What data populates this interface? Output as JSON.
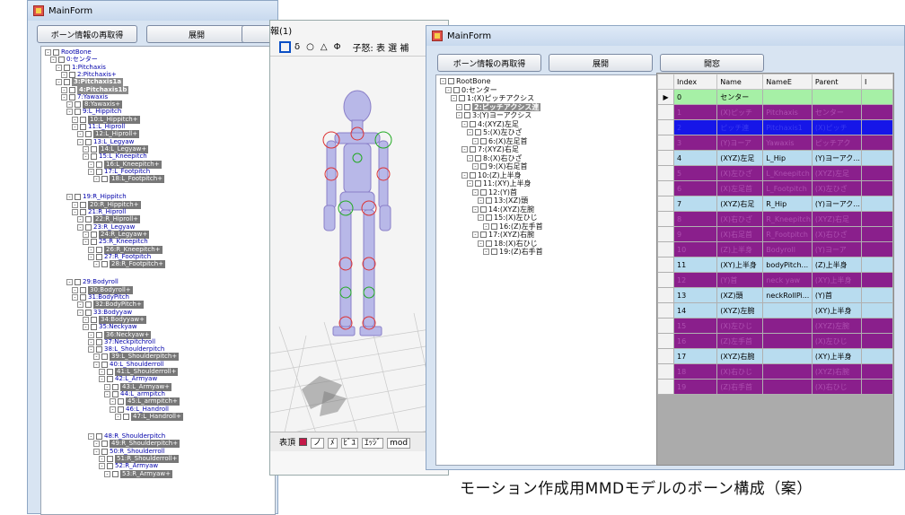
{
  "colors": {
    "row_green": "#a6f0a6",
    "row_purple": "#8a1f8c",
    "row_blue": "#1616e8",
    "row_cyan": "#b8dcef",
    "row_purple_text": "#ad4fb0"
  },
  "left_window": {
    "title": "MainForm",
    "btn_reload": "ボーン情報の再取得",
    "btn_expand": "展開",
    "tree": [
      "RootBone",
      "0:センター",
      "1:Pitchaxis",
      "2:Pitchaxis+",
      "3:Pitchaxis1a",
      "4:Pitchaxis1b",
      "7:Yawaxis",
      "8:Yawaxis+",
      "9:L_Hippitch",
      "10:L_Hippitch+",
      "11:L_Hiproll",
      "12:L_Hiproll+",
      "13:L_Legyaw",
      "14:L_Legyaw+",
      "15:L_Kneepitch",
      "16:L_Kneepitch+",
      "17:L_Footpitch",
      "18:L_Footpitch+",
      "19:R_Hippitch",
      "20:R_Hippitch+",
      "21:R_Hiproll",
      "22:R_Hiproll+",
      "23:R_Legyaw",
      "24:R_Legyaw+",
      "25:R_Kneepitch",
      "26:R_Kneepitch+",
      "27:R_Footpitch",
      "28:R_Footpitch+",
      "29:Bodyroll",
      "30:Bodyroll+",
      "31:BodyPitch",
      "32:BodyPitch+",
      "33:Bodyyaw",
      "34:Bodyyaw+",
      "35:Neckyaw",
      "36:Neckyaw+",
      "37:Neckpitchroll",
      "38:L_Shoulderpitch",
      "39:L_Shoulderpitch+",
      "40:L_Shoulderroll",
      "41:L_Shoulderroll+",
      "42:L_Armyaw",
      "43:L_Armyaw+",
      "44:L_armpitch",
      "45:L_armpitch+",
      "46:L_Handroll",
      "47:L_Handroll+",
      "48:R_Shoulderpitch",
      "49:R_Shoulderpitch+",
      "50:R_Shoulderroll",
      "51:R_Shoulderroll+",
      "52:R_Armyaw",
      "53:R_Armyaw+"
    ]
  },
  "middle_window": {
    "title_fragment": "報(1)",
    "toolbar_symbols": [
      "δ",
      "○",
      "△",
      "Φ"
    ],
    "toolbar_text": "子怒: 表 選 補",
    "status_text": "表頂",
    "status_items": [
      "ノ",
      "ﾒ",
      "ﾋﾞﾕ",
      "ｴｯｼﾞ",
      "mod"
    ]
  },
  "right_window": {
    "title": "MainForm",
    "btn_reload": "ボーン情報の再取得",
    "btn_expand": "展開",
    "btn_open": "開窓",
    "tree": [
      "RootBone",
      "0:センター",
      "1:(X)ピッチアクシス",
      "2:ピッチアクシス連",
      "3:(Y)ヨーアクシス",
      "4:(XYZ)左足",
      "5:(X)左ひざ",
      "6:(X)左足首",
      "7:(XYZ)右足",
      "8:(X)右ひざ",
      "9:(X)右足首",
      "10:(Z)上半身",
      "11:(XY)上半身",
      "12:(Y)首",
      "13:(XZ)頭",
      "14:(XYZ)左腕",
      "15:(X)左ひじ",
      "16:(Z)左手首",
      "17:(XYZ)右腕",
      "18:(X)右ひじ",
      "19:(Z)右手首"
    ],
    "grid": {
      "columns": [
        "Index",
        "Name",
        "NameE",
        "Parent",
        "I"
      ],
      "rows": [
        {
          "index": "0",
          "name": "センター",
          "nameE": "",
          "parent": "",
          "style": "green",
          "current": true
        },
        {
          "index": "1",
          "name": "(X)ピッチ",
          "nameE": "Pitchaxis",
          "parent": "センター",
          "style": "purple"
        },
        {
          "index": "2",
          "name": "ピッチ連",
          "nameE": "Pitchaxis1",
          "parent": "(X)ピッチ",
          "style": "blue"
        },
        {
          "index": "3",
          "name": "(Y)ヨーア",
          "nameE": "Yawaxis",
          "parent": "ピッチアク",
          "style": "purple"
        },
        {
          "index": "4",
          "name": "(XYZ)左足",
          "nameE": "L_Hip",
          "parent": "(Y)ヨーアク...",
          "style": "cyan"
        },
        {
          "index": "5",
          "name": "(X)左ひざ",
          "nameE": "L_Kneepitch",
          "parent": "(XYZ)左足",
          "style": "purple"
        },
        {
          "index": "6",
          "name": "(X)左足首",
          "nameE": "L_Footpitch",
          "parent": "(X)左ひざ",
          "style": "purple"
        },
        {
          "index": "7",
          "name": "(XYZ)右足",
          "nameE": "R_Hip",
          "parent": "(Y)ヨーアク...",
          "style": "cyan"
        },
        {
          "index": "8",
          "name": "(X)右ひざ",
          "nameE": "R_Kneepitch",
          "parent": "(XYZ)右足",
          "style": "purple"
        },
        {
          "index": "9",
          "name": "(X)右足首",
          "nameE": "R_Footpitch",
          "parent": "(X)右ひざ",
          "style": "purple"
        },
        {
          "index": "10",
          "name": "(Z)上半身",
          "nameE": "Bodyroll",
          "parent": "(Y)ヨーア",
          "style": "purple"
        },
        {
          "index": "11",
          "name": "(XY)上半身",
          "nameE": "bodyPitch...",
          "parent": "(Z)上半身",
          "style": "cyan"
        },
        {
          "index": "12",
          "name": "(Y)首",
          "nameE": "neck yaw",
          "parent": "(XY)上半身",
          "style": "purple"
        },
        {
          "index": "13",
          "name": "(XZ)頭",
          "nameE": "neckRollPi...",
          "parent": "(Y)首",
          "style": "cyan"
        },
        {
          "index": "14",
          "name": "(XYZ)左腕",
          "nameE": "",
          "parent": "(XY)上半身",
          "style": "cyan"
        },
        {
          "index": "15",
          "name": "(X)左ひじ",
          "nameE": "",
          "parent": "(XYZ)左腕",
          "style": "purple"
        },
        {
          "index": "16",
          "name": "(Z)左手首",
          "nameE": "",
          "parent": "(X)左ひじ",
          "style": "purple"
        },
        {
          "index": "17",
          "name": "(XYZ)右腕",
          "nameE": "",
          "parent": "(XY)上半身",
          "style": "cyan"
        },
        {
          "index": "18",
          "name": "(X)右ひじ",
          "nameE": "",
          "parent": "(XYZ)右腕",
          "style": "purple"
        },
        {
          "index": "19",
          "name": "(Z)右手首",
          "nameE": "",
          "parent": "(X)右ひじ",
          "style": "purple"
        }
      ]
    }
  },
  "caption": "モーション作成用MMDモデルのボーン構成（案）"
}
